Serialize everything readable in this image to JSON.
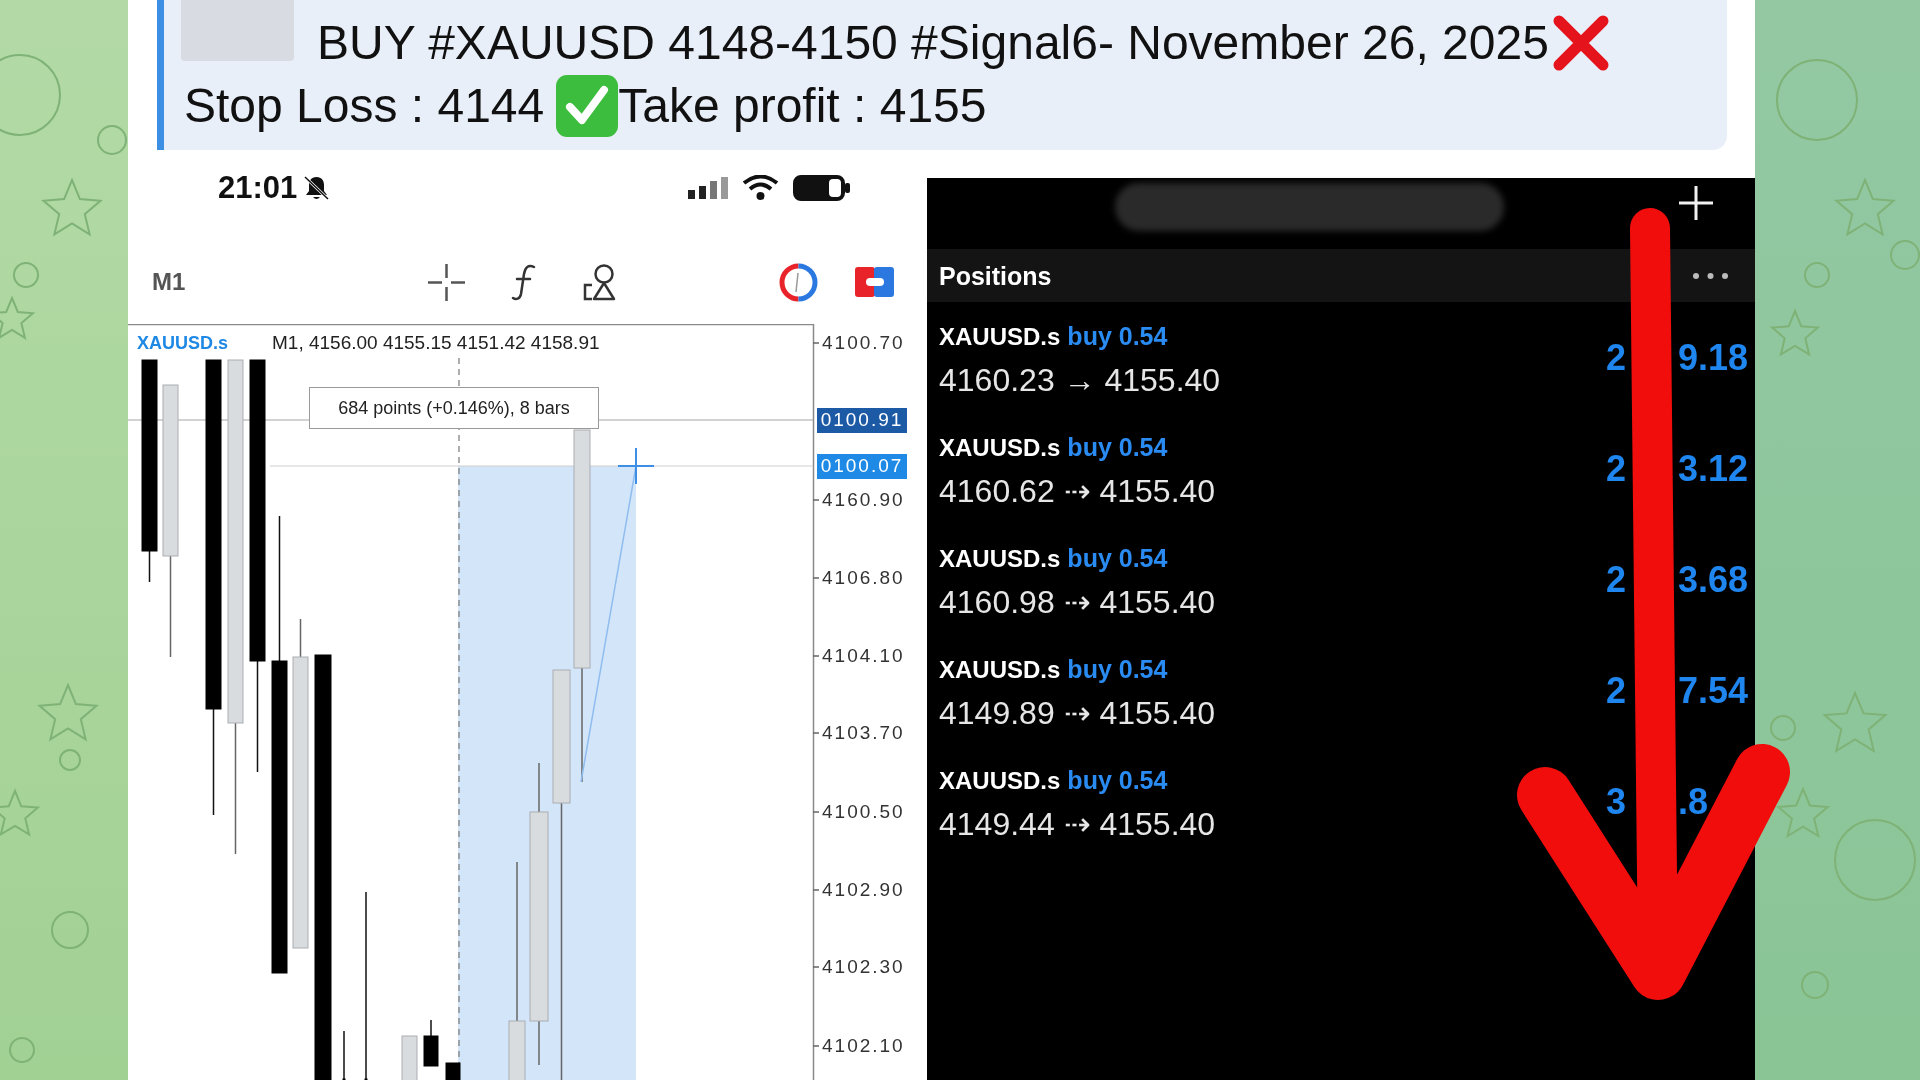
{
  "caption": {
    "signal": "BUY #XAUUSD 4148-4150 #Signal6- November 26, 2025",
    "stop_loss": "Stop Loss : 4144",
    "take_profit": "Take profit : 4155"
  },
  "chart_screen": {
    "status_time": "21:01",
    "timeframe": "M1",
    "symbol": "XAUUSD.s",
    "ohlc": "M1, 4156.00 4155.15 4151.42 4158.91",
    "measure": "684 points (+0.146%), 8 bars",
    "price_axis": [
      {
        "text": "4100.70",
        "kind": "tick"
      },
      {
        "text": "0100.91",
        "kind": "price"
      },
      {
        "text": "0100.07",
        "kind": "cursor"
      },
      {
        "text": "4160.90",
        "kind": "tick"
      },
      {
        "text": "4106.80",
        "kind": "tick"
      },
      {
        "text": "4104.10",
        "kind": "tick"
      },
      {
        "text": "4103.70",
        "kind": "tick"
      },
      {
        "text": "4100.50",
        "kind": "tick"
      },
      {
        "text": "4102.90",
        "kind": "tick"
      },
      {
        "text": "4102.30",
        "kind": "tick"
      },
      {
        "text": "4102.10",
        "kind": "tick"
      }
    ]
  },
  "positions_screen": {
    "title": "Positions",
    "positions": [
      {
        "symbol": "XAUUSD.s",
        "trade": "buy 0.54",
        "prices": "4160.23 → 4155.40",
        "profit_parts": [
          "2",
          "9.18"
        ]
      },
      {
        "symbol": "XAUUSD.s",
        "trade": "buy 0.54",
        "prices": "4160.62 ⇢ 4155.40",
        "profit_parts": [
          "2",
          "3.12"
        ]
      },
      {
        "symbol": "XAUUSD.s",
        "trade": "buy 0.54",
        "prices": "4160.98 ⇢ 4155.40",
        "profit_parts": [
          "2",
          "3.68"
        ]
      },
      {
        "symbol": "XAUUSD.s",
        "trade": "buy 0.54",
        "prices": "4149.89 ⇢ 4155.40",
        "profit_parts": [
          "2",
          "7.54"
        ]
      },
      {
        "symbol": "XAUUSD.s",
        "trade": "buy 0.54",
        "prices": "4149.44 ⇢ 4155.40",
        "profit_parts": [
          "3",
          ".8"
        ]
      }
    ]
  }
}
